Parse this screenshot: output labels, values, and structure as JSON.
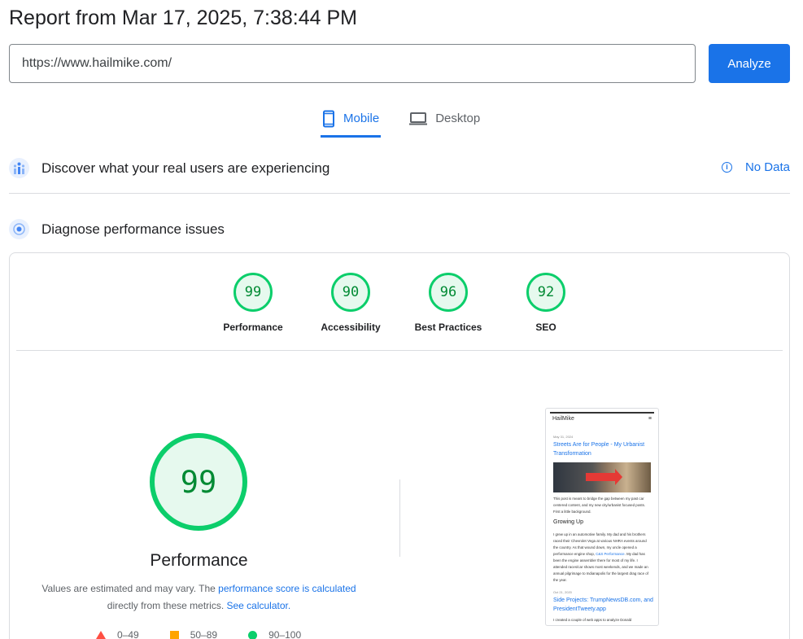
{
  "report": {
    "title": "Report from Mar 17, 2025, 7:38:44 PM"
  },
  "search": {
    "url_value": "https://www.hailmike.com/",
    "analyze_label": "Analyze"
  },
  "tabs": [
    {
      "label": "Mobile"
    },
    {
      "label": "Desktop"
    }
  ],
  "field_data": {
    "title": "Discover what your real users are experiencing",
    "status": "No Data"
  },
  "lab_data": {
    "title": "Diagnose performance issues"
  },
  "categories": [
    {
      "label": "Performance",
      "score": "99"
    },
    {
      "label": "Accessibility",
      "score": "90"
    },
    {
      "label": "Best Practices",
      "score": "96"
    },
    {
      "label": "SEO",
      "score": "92"
    }
  ],
  "performance": {
    "score": "99",
    "label": "Performance",
    "note_prefix": "Values are estimated and may vary. The ",
    "note_link1": "performance score is calculated",
    "note_middle": "directly from these metrics. ",
    "note_link2": "See calculator."
  },
  "legend": [
    {
      "range": "0–49"
    },
    {
      "range": "50–89"
    },
    {
      "range": "90–100"
    }
  ],
  "preview": {
    "site_name": "HailMike",
    "menu_glyph": "≡",
    "post1_date": "May 31, 2024",
    "post1_title": "Streets Are for People - My Urbanist Transformation",
    "post1_excerpt": "This post is meant to bridge the gap between my past car centered content, and my new city/urbanist focused posts. First a little background.",
    "heading": "Growing Up",
    "para_part1": "I grew up in an automotive family. My dad and his brothers raced their Chevrolet Vega at various NHRA events around the country. As that wound down, my uncle opened a performance engine shop, ",
    "para_link": "C&S Performance",
    "para_part2": ". My dad has been the engine assembler there for most of my life. I attended races/car shows most weekends, and we made an annual pilgrimage to Indianapolis for the largest drag race of the year.",
    "post2_date": "Oct 21, 2020",
    "post2_title": "Side Projects: TrumpNewsDB.com, and PresidentTweety.app",
    "post2_excerpt": "I created a couple of web apps to analyze Donald"
  },
  "colors": {
    "accent": "#1a73e8",
    "pass": "#0cce6b",
    "average": "#ffa400",
    "fail": "#ff4e42"
  }
}
